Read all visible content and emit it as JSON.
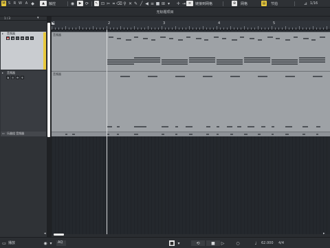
{
  "toolbar": {
    "m_label": "M",
    "s_label": "S",
    "r_label": "R",
    "w_label": "W",
    "a_label": "A",
    "touch_mode": "触控",
    "snap_mode": "链接到网格",
    "grid_type": "网格",
    "quantize_value": "节拍",
    "quantize_fraction": "1/16"
  },
  "project": {
    "title": "无标题项目"
  },
  "inspector": {
    "counter": "1 / 3"
  },
  "tracks": [
    {
      "name": "音频器",
      "part_label": "音频器"
    },
    {
      "name": "音频器",
      "part_label": "音频器"
    },
    {
      "name": "乐器组 音频器"
    }
  ],
  "ruler": {
    "bars": [
      "1",
      "2",
      "3",
      "4",
      "5"
    ]
  },
  "transport": {
    "left_label": "播放",
    "aq_label": "AQ",
    "tempo": "62.000",
    "signature": "4/4"
  },
  "colors": {
    "accent": "#e8c93c",
    "record": "#d33a3a",
    "part": "#9ea2a6"
  }
}
